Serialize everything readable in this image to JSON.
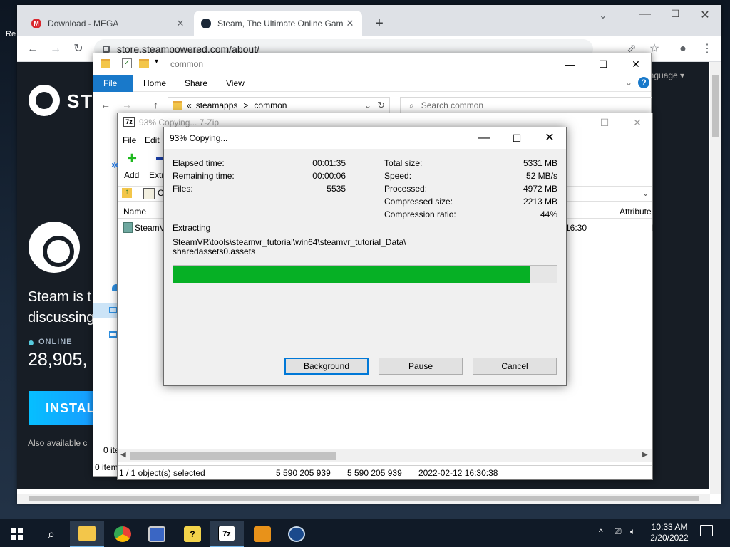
{
  "desktop": {
    "corner_text": "Re"
  },
  "chrome": {
    "tabs": [
      {
        "title": "Download - MEGA",
        "icon": "mega-icon",
        "color": "#d9272e"
      },
      {
        "title": "Steam, The Ultimate Online Gam",
        "icon": "steam-icon",
        "color": "#1b2838"
      }
    ],
    "new_tab": "+",
    "url": "store.steampowered.com/about/"
  },
  "steam_page": {
    "wordmark": "STI",
    "language": "anguage ▾",
    "tagline_1": "Steam is t",
    "tagline_2": "discussing",
    "online_label": "ONLINE",
    "online_count": "28,905,",
    "install_label": "INSTAL",
    "also_available": "Also available c"
  },
  "explorer": {
    "title": "common",
    "ribbon_tabs": [
      "File",
      "Home",
      "Share",
      "View"
    ],
    "breadcrumb": [
      "«",
      "steamapps",
      ">",
      "common"
    ],
    "search_placeholder": "Search common",
    "left_status": "0 ite",
    "bottom_status": "0 item"
  },
  "sevenzip": {
    "title": "93% Copying... 7-Zip",
    "menu": [
      "File",
      "Edit"
    ],
    "toolbar": [
      "Add",
      "Extr"
    ],
    "columns": {
      "name": "Name",
      "attributes": "Attribute"
    },
    "row": {
      "name": "SteamV",
      "time": "16:30",
      "attr": "I"
    },
    "status": [
      "1 / 1 object(s) selected",
      "5 590 205 939",
      "5 590 205 939",
      "2022-02-12 16:30:38"
    ]
  },
  "dialog": {
    "title": "93% Copying...",
    "left": [
      {
        "label": "Elapsed time:",
        "value": "00:01:35"
      },
      {
        "label": "Remaining time:",
        "value": "00:00:06"
      },
      {
        "label": "Files:",
        "value": "5535"
      }
    ],
    "right": [
      {
        "label": "Total size:",
        "value": "5331 MB"
      },
      {
        "label": "Speed:",
        "value": "52 MB/s"
      },
      {
        "label": "Processed:",
        "value": "4972 MB"
      },
      {
        "label": "Compressed size:",
        "value": "2213 MB"
      },
      {
        "label": "Compression ratio:",
        "value": "44%"
      }
    ],
    "action": "Extracting",
    "path_line1": "SteamVR\\tools\\steamvr_tutorial\\win64\\steamvr_tutorial_Data\\",
    "path_line2": "sharedassets0.assets",
    "progress": 0.93,
    "buttons": {
      "background": "Background",
      "pause": "Pause",
      "cancel": "Cancel"
    }
  },
  "taskbar": {
    "icons": [
      "start-icon",
      "search-icon",
      "file-explorer-icon",
      "chrome-icon",
      "remote-desktop-icon",
      "help-icon",
      "sevenzip-icon",
      "folder-app-icon",
      "steam-icon"
    ],
    "time": "10:33 AM",
    "date": "2/20/2022"
  },
  "colors": {
    "progress": "#06b025",
    "accent": "#0078d7"
  }
}
